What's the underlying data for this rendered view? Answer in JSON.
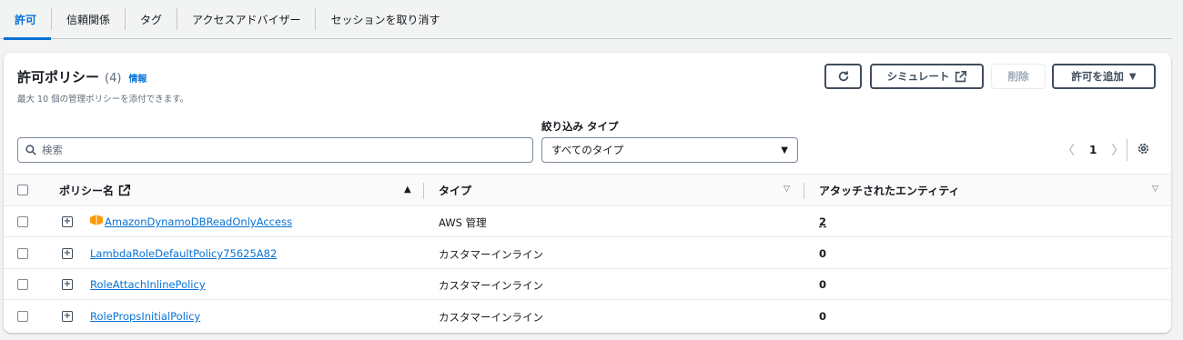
{
  "tabs": [
    {
      "label": "許可",
      "active": true
    },
    {
      "label": "信頼関係",
      "active": false
    },
    {
      "label": "タグ",
      "active": false
    },
    {
      "label": "アクセスアドバイザー",
      "active": false
    },
    {
      "label": "セッションを取り消す",
      "active": false
    }
  ],
  "panel": {
    "title": "許可ポリシー",
    "count": "(4)",
    "info": "情報",
    "subtitle": "最大 10 個の管理ポリシーを添付できます。",
    "buttons": {
      "refresh_icon": "refresh-icon",
      "simulate": "シミュレート",
      "delete": "削除",
      "add": "許可を追加"
    },
    "filter_label": "絞り込み タイプ",
    "search_placeholder": "検索",
    "filter_value": "すべてのタイプ",
    "page": "1"
  },
  "table": {
    "columns": [
      "ポリシー名",
      "タイプ",
      "アタッチされたエンティティ"
    ],
    "rows": [
      {
        "name": "AmazonDynamoDBReadOnlyAccess",
        "type": "AWS 管理",
        "entities": "2",
        "aws_managed": true
      },
      {
        "name": "LambdaRoleDefaultPolicy75625A82",
        "type": "カスタマーインライン",
        "entities": "0",
        "aws_managed": false
      },
      {
        "name": "RoleAttachInlinePolicy",
        "type": "カスタマーインライン",
        "entities": "0",
        "aws_managed": false
      },
      {
        "name": "RolePropsInitialPolicy",
        "type": "カスタマーインライン",
        "entities": "0",
        "aws_managed": false
      }
    ]
  },
  "colors": {
    "accent": "#0972d3",
    "aws_orange": "#ff9900"
  }
}
